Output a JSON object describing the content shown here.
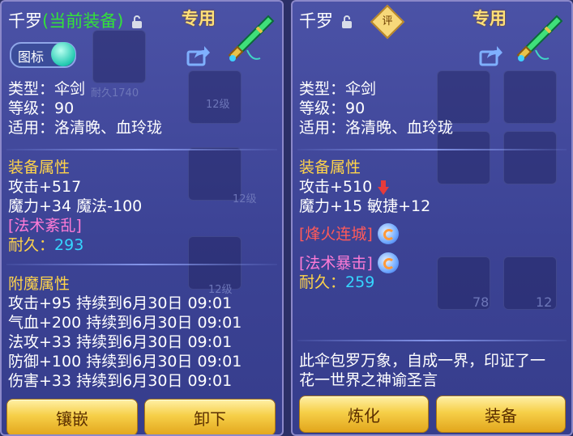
{
  "left": {
    "name": "千罗",
    "status": "(当前装备)",
    "exclusive": "专用",
    "icon_toggle_label": "图标",
    "bg_texts": [
      "耐久1740",
      "12级",
      "12级",
      "12级"
    ],
    "type": "类型：伞剑",
    "level": "等级：90",
    "applies": "适用：洛清晚、血玲珑",
    "equip_attr_title": "装备属性",
    "attack": "攻击+517",
    "magic": "魔力+34 魔法-100",
    "special": "[法术紊乱]",
    "durability_label": "耐久：",
    "durability_value": "293",
    "enchant_title": "附魔属性",
    "enchants": [
      "攻击+95 持续到6月30日 09:01",
      "气血+200 持续到6月30日 09:01",
      "法攻+33 持续到6月30日 09:01",
      "防御+100 持续到6月30日 09:01",
      "伤害+33 持续到6月30日 09:01"
    ],
    "btn_inlay": "镶嵌",
    "btn_unequip": "卸下"
  },
  "right": {
    "name": "千罗",
    "rate_label": "评",
    "exclusive": "专用",
    "bg_texts": [
      "78",
      "12"
    ],
    "type": "类型：伞剑",
    "level": "等级：90",
    "applies": "适用：洛清晚、血玲珑",
    "equip_attr_title": "装备属性",
    "attack": "攻击+510",
    "magic": "魔力+15 敏捷+12",
    "special1": "[烽火连城]",
    "special2": "[法术暴击]",
    "durability_label": "耐久：",
    "durability_value": "259",
    "desc_line1": "此伞包罗万象，自成一界，印证了一",
    "desc_line2": "花一世界之神谕圣言",
    "btn_refine": "炼化",
    "btn_equip": "装备"
  },
  "colors": {
    "green": "#33e13a",
    "gold": "#ffd44a",
    "cyan": "#35d6ff",
    "pink": "#ff7bd6",
    "red": "#ff5a5a",
    "button": "#f6cf48"
  },
  "icons": [
    "lock-icon",
    "share-icon",
    "weapon-umbrella-sword-icon",
    "swirl-skill-icon",
    "down-arrow-icon",
    "rating-badge-icon"
  ]
}
